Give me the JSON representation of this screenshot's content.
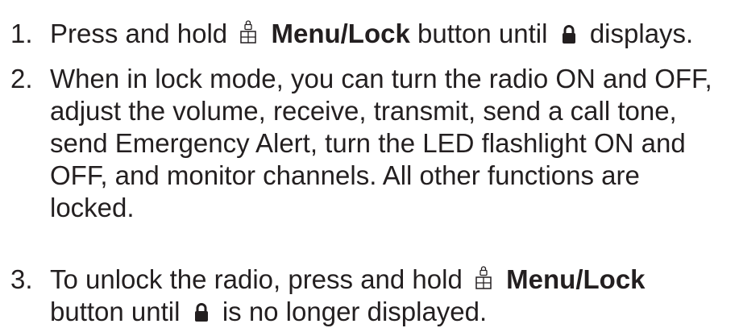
{
  "steps": [
    {
      "number": "1.",
      "pre_text": "Press and hold",
      "button_label": "Menu/Lock",
      "mid_text": "button until",
      "post_text": "displays."
    },
    {
      "number": "2.",
      "lines": [
        "When in lock mode, you can turn the radio ON and OFF,",
        "adjust the volume, receive, transmit, send a call tone,",
        "send Emergency Alert, turn the LED flashlight ON and",
        "OFF, and monitor channels. All other functions are",
        "locked."
      ]
    },
    {
      "number": "3.",
      "pre_text": "To unlock the radio, press and hold",
      "button_label": "Menu/Lock",
      "line2_pre": "button until",
      "line2_post": "is no longer displayed."
    }
  ],
  "icons": {
    "menu_lock_button": "menu-lock-icon",
    "lock_symbol": "lock-icon"
  }
}
